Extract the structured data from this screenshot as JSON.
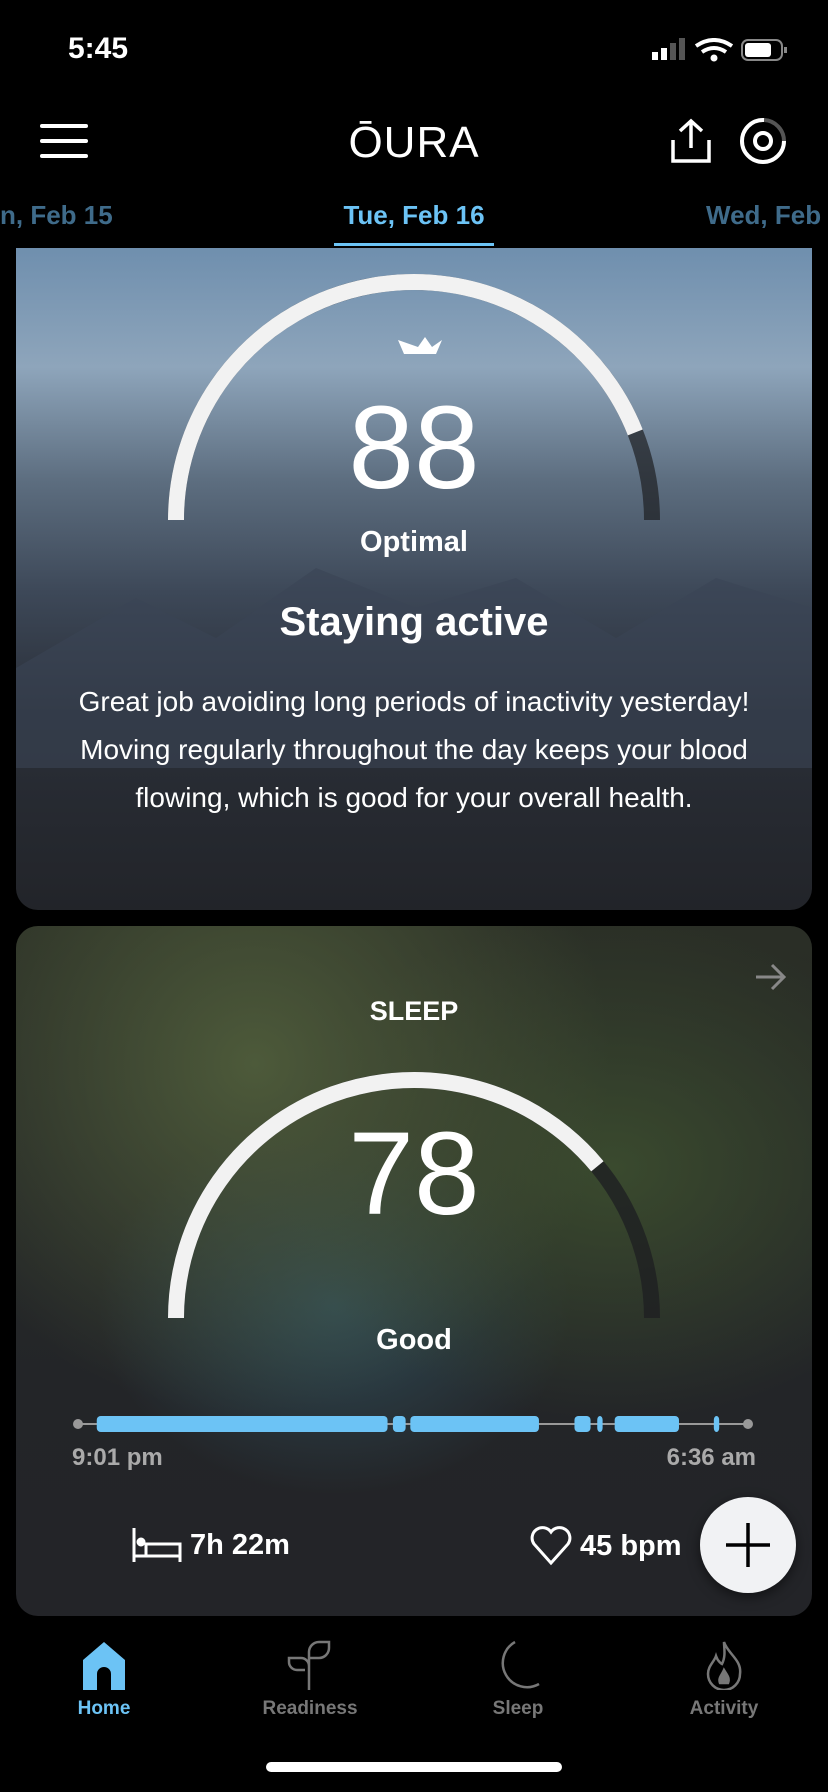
{
  "status": {
    "time": "5:45"
  },
  "header": {
    "logo": "ŌURA",
    "icons": [
      "menu-icon",
      "share-icon",
      "ring-icon"
    ]
  },
  "dates": {
    "prev": "n, Feb 15",
    "current": "Tue, Feb 16",
    "next": "Wed, Feb"
  },
  "readiness": {
    "score": "88",
    "score_value": 88,
    "rating": "Optimal",
    "title": "Staying active",
    "body": "Great job avoiding long periods of inactivity yesterday! Moving regularly throughout the day keeps your blood flowing, which is good for your overall health."
  },
  "sleep": {
    "label": "SLEEP",
    "score": "78",
    "score_value": 78,
    "rating": "Good",
    "start": "9:01 pm",
    "end": "6:36 am",
    "duration": "7h 22m",
    "heart_rate": "45 bpm",
    "segments": [
      [
        0.028,
        0.462
      ],
      [
        0.47,
        0.489
      ],
      [
        0.496,
        0.688
      ],
      [
        0.741,
        0.765
      ],
      [
        0.775,
        0.783
      ],
      [
        0.801,
        0.897
      ],
      [
        0.949,
        0.957
      ]
    ]
  },
  "nav": {
    "items": [
      {
        "label": "Home",
        "icon": "home-icon",
        "active": true
      },
      {
        "label": "Readiness",
        "icon": "sprout-icon"
      },
      {
        "label": "Sleep",
        "icon": "moon-icon"
      },
      {
        "label": "Activity",
        "icon": "flame-icon"
      }
    ]
  },
  "colors": {
    "accent": "#6cc3f5",
    "track": "#1e1f22",
    "card": "#232428"
  }
}
